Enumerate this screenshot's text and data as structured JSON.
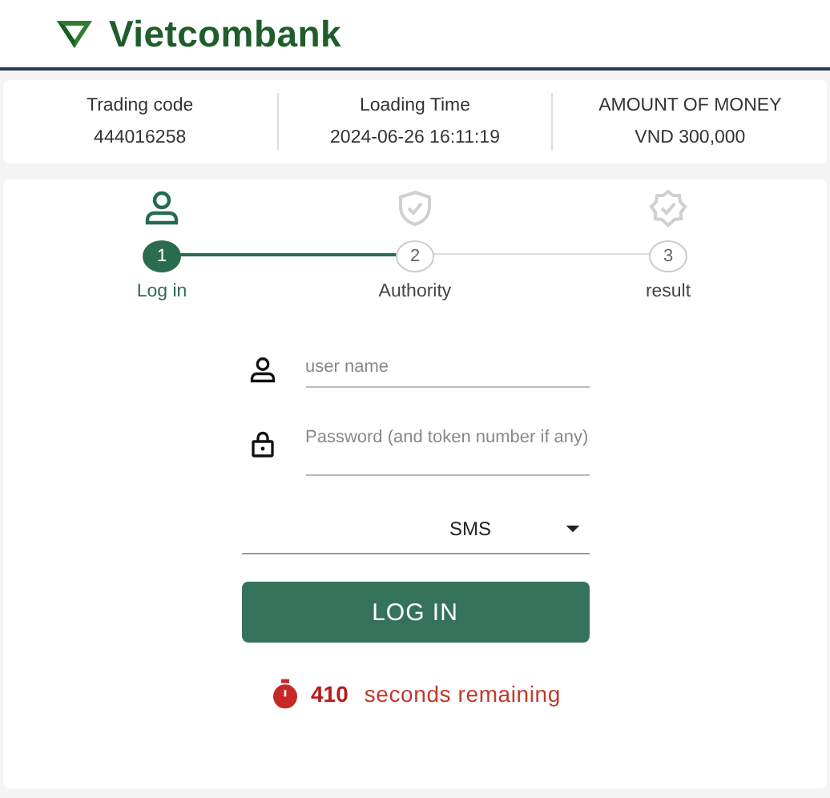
{
  "header": {
    "brand": "Vietcombank"
  },
  "transaction": [
    {
      "label": "Trading code",
      "value": "444016258"
    },
    {
      "label": "Loading Time",
      "value": "2024-06-26 16:11:19"
    },
    {
      "label": "AMOUNT OF MONEY",
      "value": "VND 300,000"
    }
  ],
  "steps": [
    {
      "kind": "person",
      "number": "1",
      "label": "Log in",
      "active": true
    },
    {
      "kind": "shield",
      "number": "2",
      "label": "Authority",
      "active": false
    },
    {
      "kind": "badge",
      "number": "3",
      "label": "result",
      "active": false
    }
  ],
  "form": {
    "username": {
      "placeholder": "user name"
    },
    "password": {
      "placeholder": "Password (and token number if any)"
    },
    "method": {
      "value": "SMS"
    },
    "submit": "LOG IN"
  },
  "timer": {
    "seconds": "410",
    "text": "seconds remaining"
  }
}
